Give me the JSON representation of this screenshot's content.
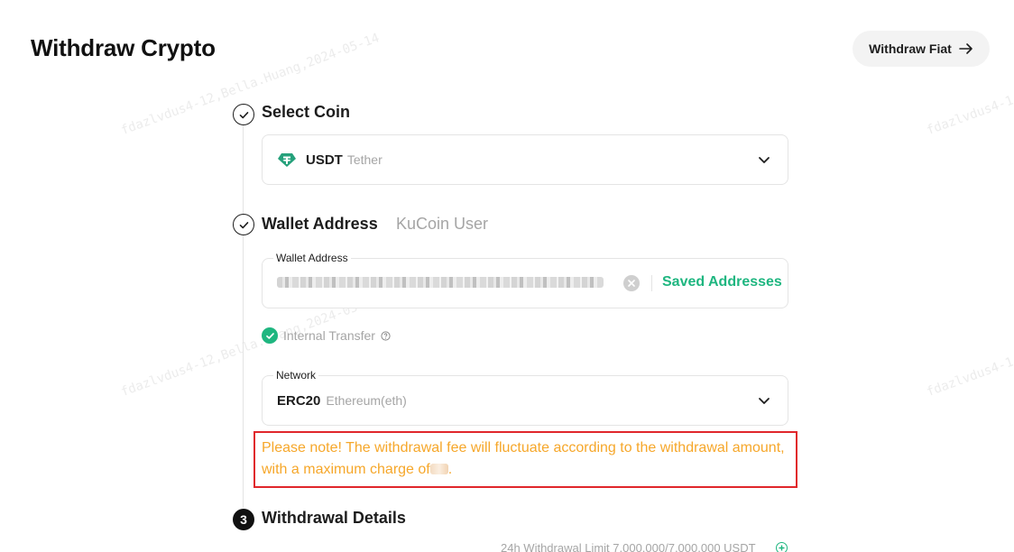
{
  "page": {
    "title": "Withdraw Crypto",
    "fiat_button": "Withdraw Fiat"
  },
  "watermark": {
    "text": "fdazlvdus4-12,Bella.Huang,2024-05-14",
    "short": "fdazlvdus4-1"
  },
  "steps": {
    "coin": {
      "title": "Select Coin",
      "symbol": "USDT",
      "name": "Tether",
      "icon": "tether-icon"
    },
    "address": {
      "title": "Wallet Address",
      "tab_alt": "KuCoin User",
      "field_label": "Wallet Address",
      "saved_link": "Saved Addresses",
      "internal_label": "Internal Transfer",
      "network_label": "Network",
      "network_symbol": "ERC20",
      "network_name": "Ethereum(eth)"
    },
    "notice": {
      "line1": "Please note! The withdrawal fee will fluctuate according to the withdrawal amount,",
      "line2_prefix": "with a maximum charge of",
      "line2_suffix": "."
    },
    "details": {
      "number": "3",
      "title": "Withdrawal Details",
      "limit_text": "24h Withdrawal Limit 7,000,000/7,000,000 USDT"
    }
  },
  "colors": {
    "accent": "#1fb680",
    "notice_text": "#f6a72a",
    "notice_border": "#e0262b",
    "muted": "#a5a5a5"
  }
}
